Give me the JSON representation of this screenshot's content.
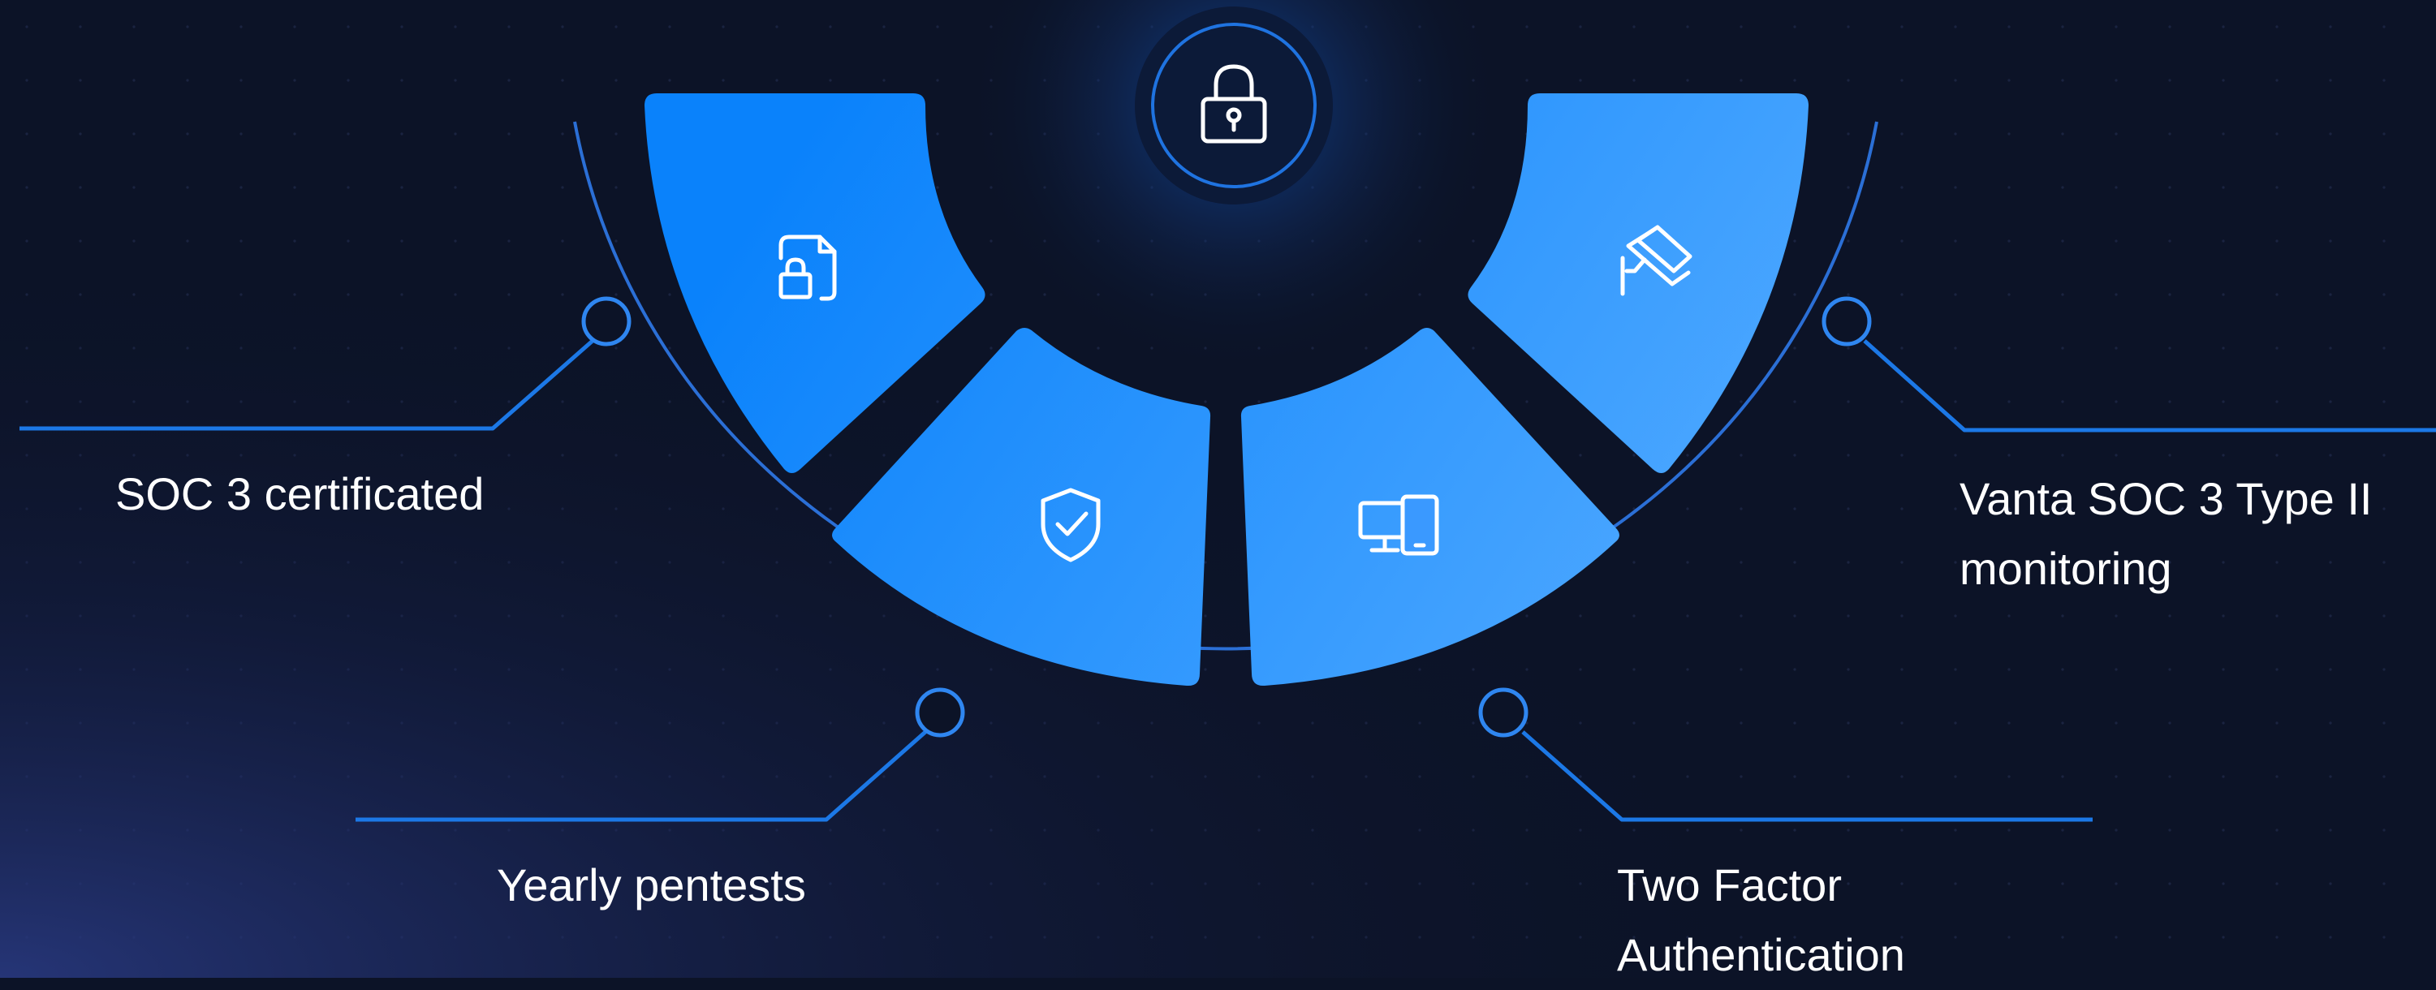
{
  "colors": {
    "background": "#0c1327",
    "segment_light": "#4aa6ff",
    "segment_dark": "#0a82fb",
    "line": "#1c78e6",
    "icon": "#ffffff"
  },
  "hub": {
    "icon": "padlock-icon"
  },
  "segments": [
    {
      "icon": "file-lock-icon"
    },
    {
      "icon": "shield-check-icon"
    },
    {
      "icon": "devices-icon"
    },
    {
      "icon": "security-camera-icon"
    }
  ],
  "callouts": {
    "soc3": {
      "lines": [
        "SOC 3 certificated"
      ]
    },
    "pentests": {
      "lines": [
        "Yearly pentests"
      ]
    },
    "two_factor": {
      "lines": [
        "Two Factor",
        "Authentication"
      ]
    },
    "vanta": {
      "lines": [
        "Vanta SOC 3 Type II",
        "monitoring"
      ]
    }
  }
}
